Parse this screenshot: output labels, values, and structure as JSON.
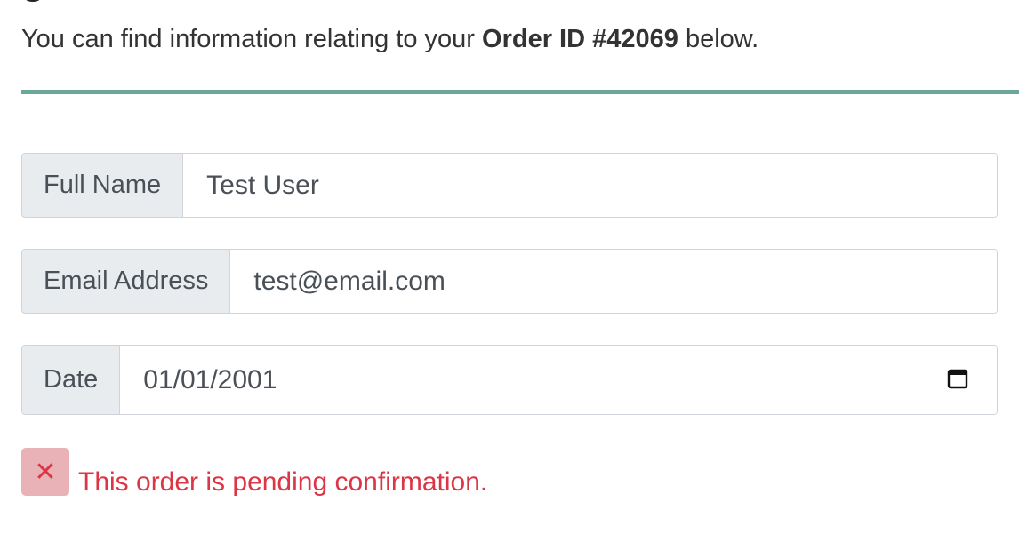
{
  "intro": {
    "prefix": "You can find information relating to your ",
    "order_label": "Order ID #42069",
    "suffix": " below."
  },
  "form": {
    "full_name": {
      "label": "Full Name",
      "value": "Test User"
    },
    "email": {
      "label": "Email Address",
      "value": "test@email.com"
    },
    "date": {
      "label": "Date",
      "value": "01/01/2001"
    }
  },
  "status": {
    "icon": "close-icon",
    "glyph": "✕",
    "message": "This order is pending confirmation.",
    "color": "#dc3545"
  },
  "colors": {
    "divider": "#6aa899",
    "addon_bg": "#e9ecef",
    "alert_icon_bg": "#e8b2b7"
  }
}
